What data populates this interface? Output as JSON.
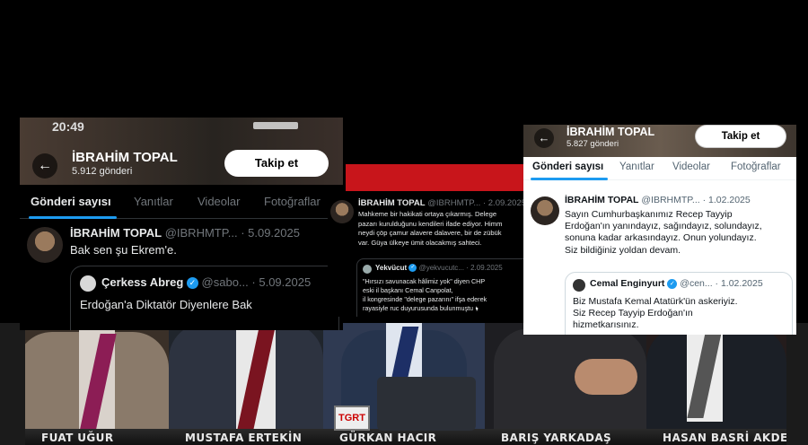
{
  "left_shot": {
    "status_time": "20:49",
    "profile_name": "İBRAHİM TOPAL",
    "post_count": "5.912 gönderi",
    "follow_label": "Takip et",
    "tabs": [
      "Gönderi sayısı",
      "Yanıtlar",
      "Videolar",
      "Fotoğraflar"
    ],
    "tweet": {
      "name": "İBRAHİM TOPAL",
      "handle": "@IBRHMTP...",
      "date": "· 5.09.2025",
      "text": "Bak sen şu Ekrem'e."
    },
    "quote": {
      "name": "Çerkess Abreg",
      "handle": "@sabo...",
      "date": "· 5.09.2025",
      "text": "Erdoğan'a Diktatör Diyenlere Bak"
    }
  },
  "middle_shot": {
    "tweet": {
      "name": "İBRAHİM TOPAL",
      "handle": "@IBRHMTP...",
      "date": "· 2.09.2025",
      "text_lines": [
        "Mahkeme bir hakikati ortaya çıkarmış. Delege",
        "pazarı kurulduğunu kendileri ifade ediyor. Himm",
        "neydi çöp çamur alavere dalavere, bir de zübük",
        "var. Güya ülkeye ümit olacakmış sahteci."
      ]
    },
    "quote": {
      "name": "Yekvücut",
      "handle": "@yekvucutc...",
      "date": "· 2.09.2025",
      "text_lines": [
        "\"Hırsızı savunacak hâlimiz yok\" diyen CHP",
        "eski il başkanı Cemal Canpolat,",
        "il kongresinde \"delege pazarını\" ifşa ederek",
        "rayasiyle ruc duyurusunda bulunmuştu 🖢"
      ]
    }
  },
  "right_shot": {
    "profile_name": "İBRAHİM TOPAL",
    "post_count": "5.827 gönderi",
    "follow_label": "Takip et",
    "tabs": [
      "Gönderi sayısı",
      "Yanıtlar",
      "Videolar",
      "Fotoğraflar"
    ],
    "tweet": {
      "name": "İBRAHİM TOPAL",
      "handle": "@IBRHMTP...",
      "date": "· 1.02.2025",
      "text_lines": [
        "Sayın Cumhurbaşkanımız Recep Tayyip",
        "Erdoğan'ın yanındayız, sağındayız, solundayız,",
        "sonuna kadar arkasındayız. Onun yolundayız.",
        "Siz bildiğiniz yoldan devam."
      ]
    },
    "quote": {
      "name": "Cemal Enginyurt",
      "handle": "@cen...",
      "date": "· 1.02.2025",
      "text_lines": [
        "Biz Mustafa Kemal Atatürk'ün askeriyiz.",
        "Siz Recep Tayyip Erdoğan'ın",
        "hizmetkarısınız."
      ]
    }
  },
  "nameplates": [
    "FUAT UĞUR",
    "MUSTAFA ERTEKİN",
    "GÜRKAN HACIR",
    "BARIŞ YARKADAŞ",
    "HASAN BASRİ AKDEMİR"
  ],
  "tv_logo": "TGRT",
  "colors": {
    "accent": "#1d9bf0",
    "studio_red": "#c8151b"
  }
}
